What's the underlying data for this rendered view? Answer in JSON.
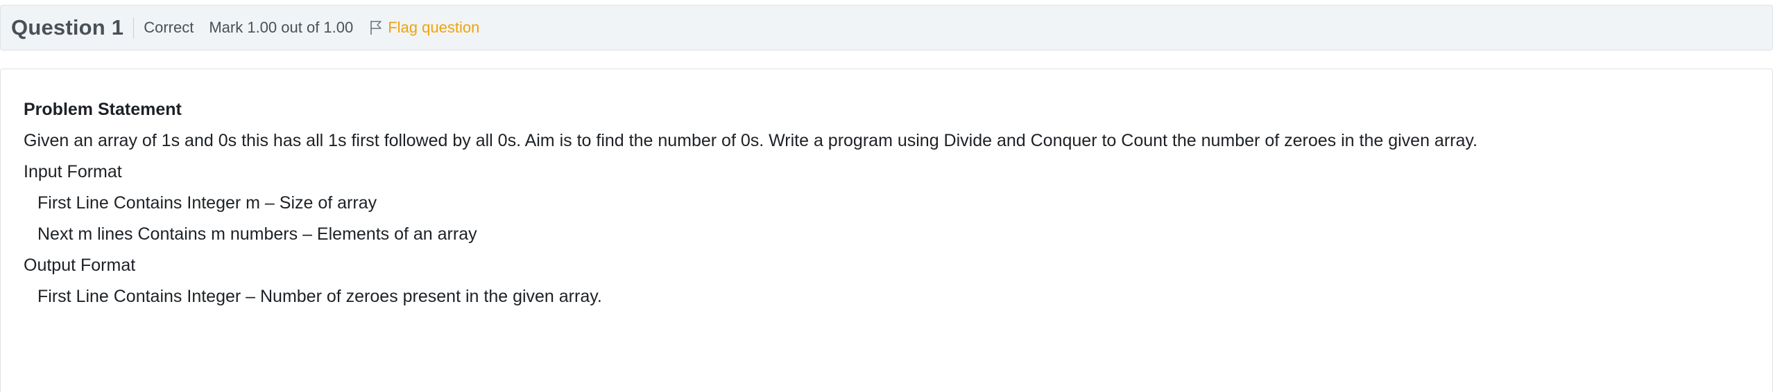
{
  "question_header": {
    "number_label": "Question 1",
    "state": "Correct",
    "grade": "Mark 1.00 out of 1.00",
    "flag_label": "Flag question",
    "flag_icon": "flag-outline-icon"
  },
  "question_text": {
    "heading": "Problem Statement",
    "description": "Given an array of 1s and 0s this has all 1s first followed by all 0s. Aim is to find the number of 0s. Write a program using Divide and Conquer to Count the number of zeroes in the given array.",
    "input_format_label": "Input Format",
    "input_line_1": "First Line Contains Integer m – Size of array",
    "input_line_2": "Next m lines Contains m numbers – Elements of an array",
    "output_format_label": "Output Format",
    "output_line_1": "First Line Contains Integer – Number of zeroes present in the given array."
  },
  "colors": {
    "info_bar_bg": "#f1f4f6",
    "flag_accent": "#f0a30a",
    "text": "#1d2125",
    "muted": "#495057"
  }
}
